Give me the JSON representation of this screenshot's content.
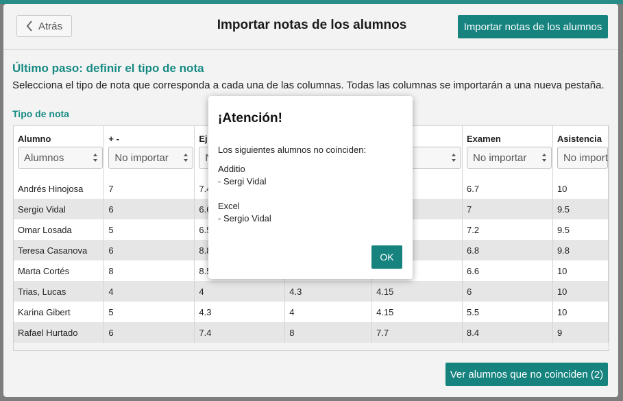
{
  "header": {
    "back_label": "Atrás",
    "title": "Importar notas de los alumnos",
    "import_label": "Importar notas de los alumnos"
  },
  "step": {
    "title": "Último paso: definir el tipo de nota",
    "description": "Selecciona el tipo de nota que corresponda a cada una de las columnas. Todas las columnas se importarán a una nueva pestaña."
  },
  "table_label": "Tipo de nota",
  "columns": [
    {
      "header": "Alumno",
      "select": "Alumnos"
    },
    {
      "header": "+ -",
      "select": "No importar"
    },
    {
      "header": "Ej",
      "select": "N"
    },
    {
      "header": "",
      "select": ""
    },
    {
      "header": "ercicios",
      "select": "ortar"
    },
    {
      "header": "Examen",
      "select": "No importar"
    },
    {
      "header": "Asistencia",
      "select": "No import"
    }
  ],
  "rows": [
    [
      "Andrés Hinojosa",
      "7",
      "7.4",
      "",
      "",
      "6.7",
      "10"
    ],
    [
      "Sergio Vidal",
      "6",
      "6.6",
      "",
      "",
      "7",
      "9.5"
    ],
    [
      "Omar Losada",
      "5",
      "6.5",
      "",
      "",
      "7.2",
      "9.5"
    ],
    [
      "Teresa Casanova",
      "6",
      "8.8",
      "",
      "",
      "6.8",
      "9.8"
    ],
    [
      "Marta Cortés",
      "8",
      "8.5",
      "",
      "",
      "6.6",
      "10"
    ],
    [
      "Trias, Lucas",
      "4",
      "4",
      "4.3",
      "4.15",
      "6",
      "10"
    ],
    [
      "Karina Gibert",
      "5",
      "4.3",
      "4",
      "4.15",
      "5.5",
      "10"
    ],
    [
      "Rafael Hurtado",
      "6",
      "7.4",
      "8",
      "7.7",
      "8.4",
      "9"
    ]
  ],
  "footer": {
    "mismatch_label": "Ver alumnos que no coinciden (2)"
  },
  "modal": {
    "title": "¡Atención!",
    "intro": "Los siguientes alumnos no coinciden:",
    "groups": [
      {
        "source": "Additio",
        "student": "- Sergi Vidal"
      },
      {
        "source": "Excel",
        "student": "- Sergio Vidal"
      }
    ],
    "ok_label": "OK"
  },
  "colors": {
    "accent": "#16837f",
    "accent_text": "#168a83",
    "overlay": "#7d7d7d"
  }
}
